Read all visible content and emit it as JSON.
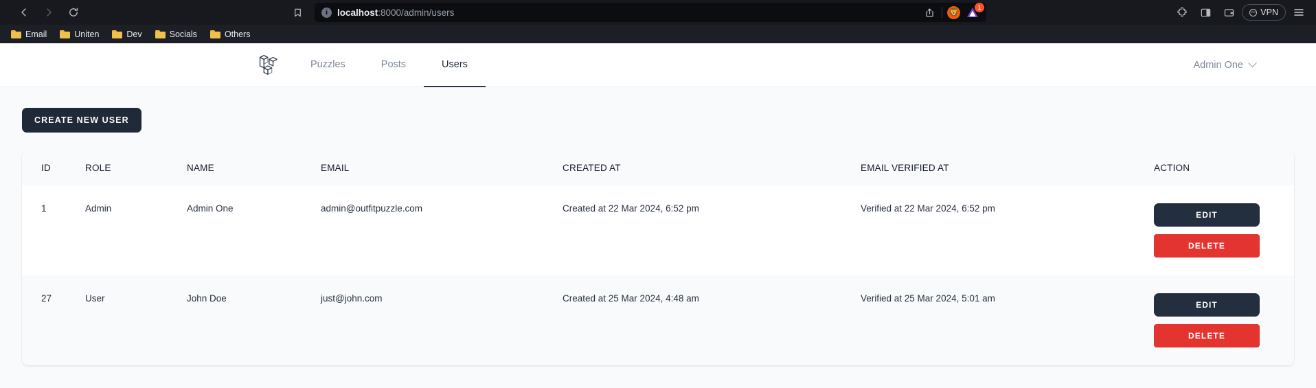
{
  "browser": {
    "back_icon": "back-arrow-icon",
    "forward_icon": "forward-arrow-icon",
    "reload_icon": "reload-icon",
    "bookmark_icon": "bookmark-icon",
    "url_host": "localhost",
    "url_rest": ":8000/admin/users",
    "share_icon": "share-icon",
    "shield_icon": "brave-shield-icon",
    "rewards_icon": "brave-rewards-icon",
    "rewards_badge": "1",
    "extensions_icon": "puzzle-piece-icon",
    "sidebar_icon": "sidebar-toggle-icon",
    "wallet_icon": "wallet-icon",
    "vpn_label": "VPN",
    "menu_icon": "hamburger-menu-icon",
    "bookmarks": [
      {
        "label": "Email"
      },
      {
        "label": "Uniten"
      },
      {
        "label": "Dev"
      },
      {
        "label": "Socials"
      },
      {
        "label": "Others"
      }
    ]
  },
  "app": {
    "brand_icon": "laravel-logo-icon",
    "nav": [
      {
        "label": "Puzzles",
        "active": false
      },
      {
        "label": "Posts",
        "active": false
      },
      {
        "label": "Users",
        "active": true
      }
    ],
    "user_menu": {
      "label": "Admin One",
      "chevron": "chevron-down-icon"
    },
    "create_button": "CREATE NEW USER",
    "table": {
      "columns": [
        "ID",
        "ROLE",
        "NAME",
        "EMAIL",
        "CREATED AT",
        "EMAIL VERIFIED AT",
        "ACTION"
      ],
      "rows": [
        {
          "id": "1",
          "role": "Admin",
          "name": "Admin One",
          "email": "admin@outfitpuzzle.com",
          "created_at": "Created at 22 Mar 2024, 6:52 pm",
          "verified_at": "Verified at 22 Mar 2024, 6:52 pm",
          "edit": "EDIT",
          "delete": "DELETE"
        },
        {
          "id": "27",
          "role": "User",
          "name": "John Doe",
          "email": "just@john.com",
          "created_at": "Created at 25 Mar 2024, 4:48 am",
          "verified_at": "Verified at 25 Mar 2024, 5:01 am",
          "edit": "EDIT",
          "delete": "DELETE"
        }
      ]
    }
  },
  "colors": {
    "primary_dark": "#1f2937",
    "danger": "#e3342f",
    "brave_orange": "#f45a08",
    "folder_yellow": "#f0bf4c",
    "page_bg": "#f8fafc"
  }
}
